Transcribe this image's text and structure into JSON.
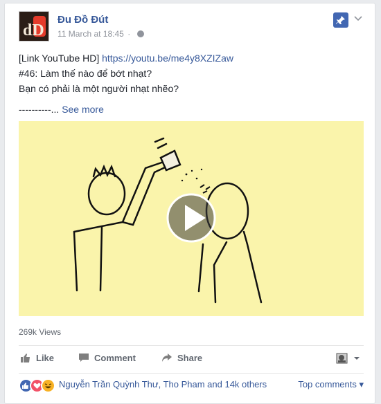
{
  "post": {
    "page_name": "Đu Đồ Đút",
    "timestamp": "11 March at 18:45",
    "avatar_text": "dD",
    "text_prefix": "[Link YouTube HD]",
    "link": "https://youtu.be/me4y8XZIZaw",
    "line2": "#46: Làm thế nào để bớt nhạt?",
    "line3": "Bạn có phải là một người nhạt nhẽo?",
    "dashes": "----------...",
    "see_more": "See more"
  },
  "video": {
    "views": "269k Views"
  },
  "actions": {
    "like": "Like",
    "comment": "Comment",
    "share": "Share"
  },
  "reactions": {
    "names": "Nguyễn Trần Quỳnh Thư, Tho Pham and 14k others",
    "top_comments": "Top comments ▾"
  },
  "colors": {
    "link": "#365899",
    "accent": "#4267b2",
    "video_bg": "#faf4ab"
  },
  "icons": [
    "globe-icon",
    "pin-icon",
    "chevron-down-icon",
    "play-icon",
    "like-icon",
    "comment-icon",
    "share-icon",
    "sticker-icon",
    "like-reaction-icon",
    "love-reaction-icon",
    "haha-reaction-icon"
  ]
}
